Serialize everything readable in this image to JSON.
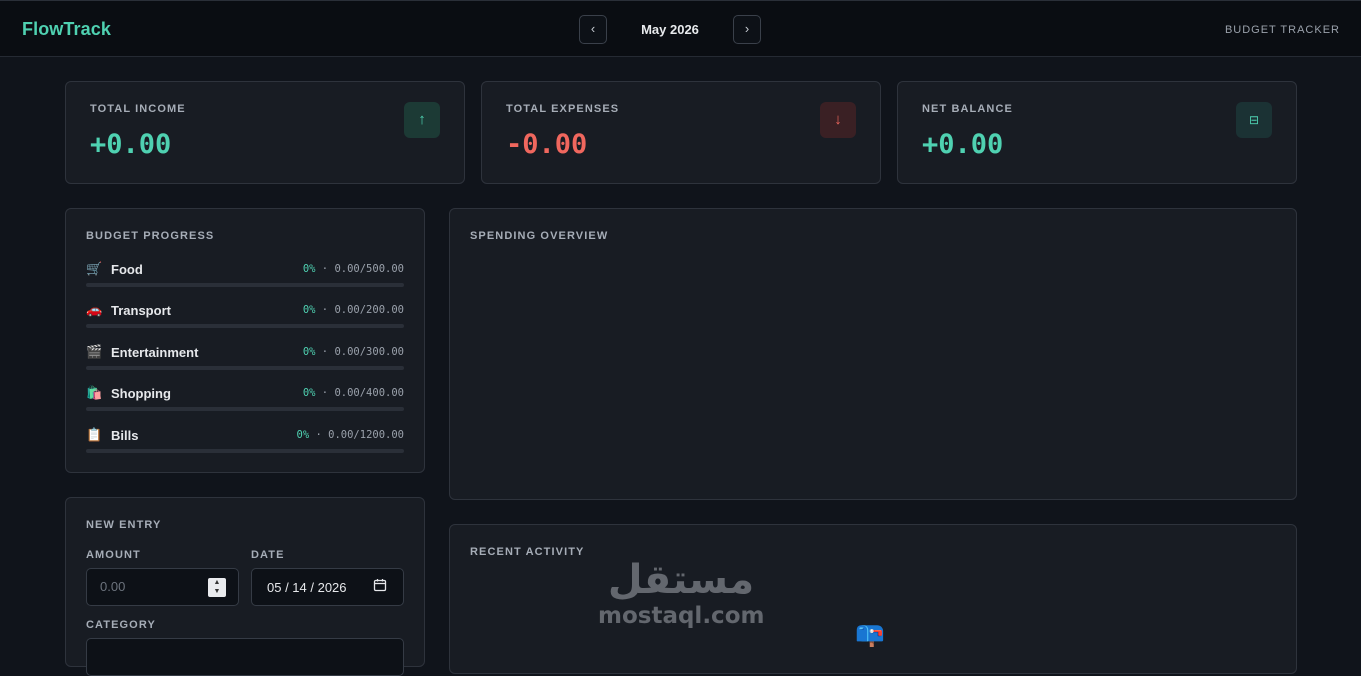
{
  "header": {
    "brand": "FlowTrack",
    "prev_icon": "‹",
    "next_icon": "›",
    "month": "May 2026",
    "subtitle": "BUDGET TRACKER"
  },
  "stats": {
    "income": {
      "label": "TOTAL INCOME",
      "value": "+0.00",
      "icon": "↑",
      "icon_name": "arrow-up-icon",
      "color": "#4fd1b1"
    },
    "expenses": {
      "label": "TOTAL EXPENSES",
      "value": "-0.00",
      "icon": "↓",
      "icon_name": "arrow-down-icon",
      "color": "#f0675e"
    },
    "balance": {
      "label": "NET BALANCE",
      "value": "+0.00",
      "icon": "⊟",
      "icon_name": "balance-icon",
      "color": "#4fd1b1"
    }
  },
  "budget": {
    "title": "BUDGET PROGRESS",
    "items": [
      {
        "emoji": "🛒",
        "name": "Food",
        "pct": "0%",
        "sep": "·",
        "amount": "0.00/500.00",
        "progress": 0
      },
      {
        "emoji": "🚗",
        "name": "Transport",
        "pct": "0%",
        "sep": "·",
        "amount": "0.00/200.00",
        "progress": 0
      },
      {
        "emoji": "🎬",
        "name": "Entertainment",
        "pct": "0%",
        "sep": "·",
        "amount": "0.00/300.00",
        "progress": 0
      },
      {
        "emoji": "🛍️",
        "name": "Shopping",
        "pct": "0%",
        "sep": "·",
        "amount": "0.00/400.00",
        "progress": 0
      },
      {
        "emoji": "📋",
        "name": "Bills",
        "pct": "0%",
        "sep": "·",
        "amount": "0.00/1200.00",
        "progress": 0
      }
    ]
  },
  "spending": {
    "title": "SPENDING OVERVIEW"
  },
  "entry": {
    "title": "NEW ENTRY",
    "amount_label": "AMOUNT",
    "amount_placeholder": "0.00",
    "date_label": "DATE",
    "date_value": "05 / 14 / 2026",
    "calendar_icon": "📅",
    "category_label": "CATEGORY"
  },
  "activity": {
    "title": "RECENT ACTIVITY",
    "empty_icon": "📪"
  },
  "watermark": {
    "logo": "مستقل",
    "sub": "mostaql.com"
  }
}
